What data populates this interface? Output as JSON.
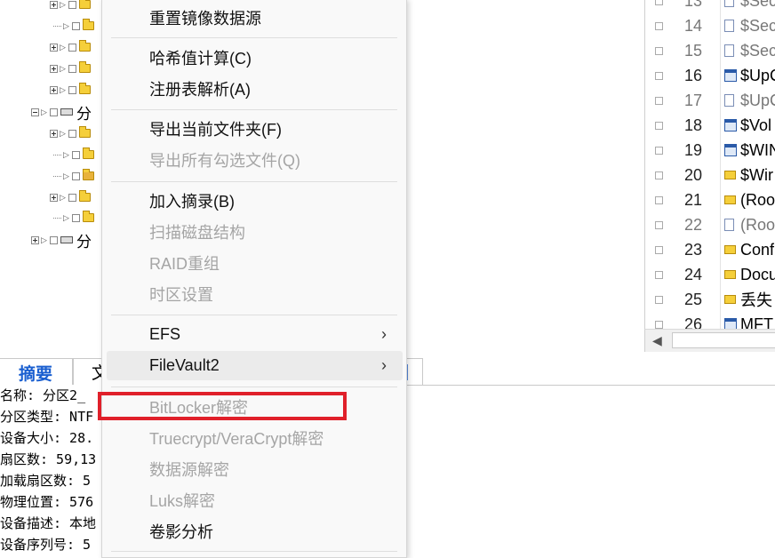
{
  "tree": {
    "partition_label": "分"
  },
  "file_list": {
    "rows": [
      {
        "num": "13",
        "name": "$Sec",
        "icon": "document-icon",
        "grey": true
      },
      {
        "num": "14",
        "name": "$Sec",
        "icon": "document-icon",
        "grey": true
      },
      {
        "num": "15",
        "name": "$Sec",
        "icon": "document-icon",
        "grey": true
      },
      {
        "num": "16",
        "name": "$UpC",
        "icon": "app-file-icon",
        "grey": false
      },
      {
        "num": "17",
        "name": "$UpC",
        "icon": "document-icon",
        "grey": true
      },
      {
        "num": "18",
        "name": "$Vol",
        "icon": "app-file-icon",
        "grey": false
      },
      {
        "num": "19",
        "name": "$WIN",
        "icon": "app-file-icon",
        "grey": false
      },
      {
        "num": "20",
        "name": "$Wir",
        "icon": "folder-icon",
        "grey": false
      },
      {
        "num": "21",
        "name": "(Roo",
        "icon": "folder-icon",
        "grey": false
      },
      {
        "num": "22",
        "name": "(Roo",
        "icon": "document-icon",
        "grey": true
      },
      {
        "num": "23",
        "name": "Conf",
        "icon": "folder-icon",
        "grey": false
      },
      {
        "num": "24",
        "name": "Docu",
        "icon": "folder-icon",
        "grey": false
      },
      {
        "num": "25",
        "name": "丢失",
        "icon": "lost-folder-icon",
        "grey": false
      },
      {
        "num": "26",
        "name": "MFT",
        "icon": "app-file-icon",
        "grey": false
      }
    ]
  },
  "tabs": {
    "summary": "摘要",
    "second": "文",
    "third": "|"
  },
  "details": [
    "名称: 分区2_",
    "分区类型: NTF",
    "设备大小: 28.",
    "扇区数: 59,13",
    "加载扇区数: 5",
    "物理位置: 576",
    "设备描述: 本地",
    "设备序列号: 5"
  ],
  "menu": {
    "items": [
      {
        "label": "重置镜像数据源",
        "disabled": false
      },
      {
        "label": "哈希值计算(C)",
        "disabled": false
      },
      {
        "label": "注册表解析(A)",
        "disabled": false
      },
      {
        "label": "导出当前文件夹(F)",
        "disabled": false
      },
      {
        "label": "导出所有勾选文件(Q)",
        "disabled": true
      },
      {
        "label": "加入摘录(B)",
        "disabled": false
      },
      {
        "label": "扫描磁盘结构",
        "disabled": true
      },
      {
        "label": "RAID重组",
        "disabled": true
      },
      {
        "label": "时区设置",
        "disabled": true
      },
      {
        "label": "EFS",
        "disabled": false,
        "submenu": true
      },
      {
        "label": "FileVault2",
        "disabled": false,
        "submenu": true,
        "hover": true
      },
      {
        "label": "BitLocker解密",
        "disabled": true
      },
      {
        "label": "Truecrypt/VeraCrypt解密",
        "disabled": true
      },
      {
        "label": "数据源解密",
        "disabled": true
      },
      {
        "label": "Luks解密",
        "disabled": true
      },
      {
        "label": "卷影分析",
        "disabled": false
      }
    ],
    "submenu_arrow": "›"
  },
  "colors": {
    "highlight_box": "#e0202a",
    "active_tab": "#1a5fd0",
    "disabled_text": "#a5a5a5"
  }
}
